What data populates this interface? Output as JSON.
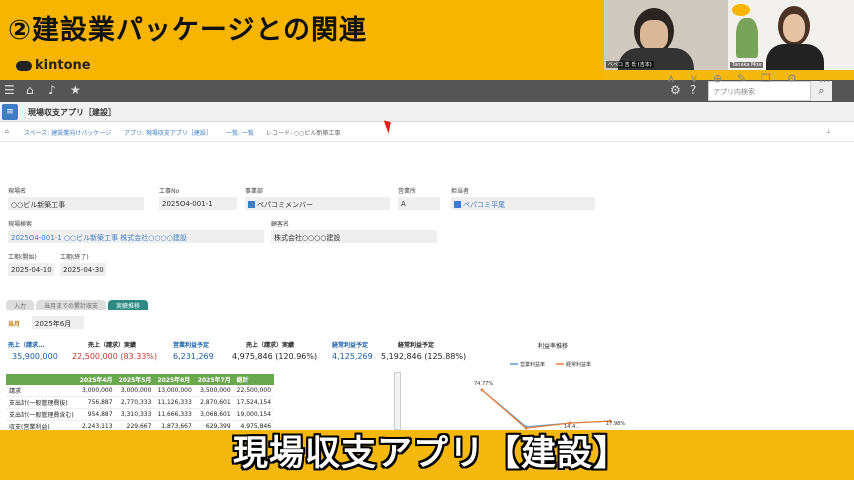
{
  "banner": {
    "title": "②建設業パッケージとの関連"
  },
  "brand": {
    "logo_text": "kintone"
  },
  "video": {
    "cam1_name": "ベペコ 吉 氏 (吉本)",
    "cam2_name": "Tanaka Moe",
    "accent": "#f7b500"
  },
  "topbar": {
    "search_placeholder": "アプリ内検索"
  },
  "app": {
    "name": "現場収支アプリ［建設］"
  },
  "breadcrumb": {
    "space": "スペース: 建設業向けパッケージ",
    "app": "アプリ: 現場収支アプリ［建設］",
    "list": "一覧: 一覧",
    "record": "レコード: ○○ビル新築工事"
  },
  "fields": {
    "site_name_label": "現場名",
    "site_name": "○○ビル新築工事",
    "job_no_label": "工事No",
    "job_no": "2025O4-001-1",
    "dept_label": "事業部",
    "dept": "ペパコミメンバー",
    "office_label": "営業所",
    "office": "A",
    "owner_label": "担当者",
    "owner": "ペパコミ平尾",
    "site_search_label": "現場検索",
    "site_search": "2025O4-001-1 ○○ビル新築工事 株式会社○○○○建設",
    "client_label": "顧客名",
    "client": "株式会社○○○○建設",
    "start_label": "工期(開始)",
    "start": "2025-04-10",
    "end_label": "工期(終了)",
    "end": "2025-04-30"
  },
  "tabs": [
    "入力",
    "当月までの累計収支",
    "実績推移"
  ],
  "month": {
    "label": "当月",
    "value": "2025年6月"
  },
  "kpis": {
    "heads": [
      "売上（請求...",
      "売上（請求）実績",
      "営業利益予定",
      "売上（請求）実績",
      "経常利益予定",
      "経常利益予定"
    ],
    "values": [
      "35,900,000",
      "22,500,000 (83.33%)",
      "6,231,269",
      "4,975,846 (120.96%)",
      "4,125,269",
      "5,192,846 (125.88%)"
    ]
  },
  "table": {
    "headers": [
      "",
      "2025年4月",
      "2025年5月",
      "2025年6月",
      "2025年7月",
      "総計"
    ],
    "rows": [
      [
        "請求",
        "3,000,000",
        "3,000,000",
        "13,000,000",
        "3,500,000",
        "22,500,000"
      ],
      [
        "支出計(一般管理費抜)",
        "756,887",
        "2,770,333",
        "11,126,333",
        "2,870,601",
        "17,524,154"
      ],
      [
        "支出計(一般管理費含む)",
        "954,887",
        "3,310,333",
        "11,666,333",
        "3,068,601",
        "19,000,154"
      ],
      [
        "収支(営業利益)",
        "2,243,113",
        "229,667",
        "1,873,667",
        "629,399",
        "4,975,846"
      ]
    ]
  },
  "chart_data": {
    "type": "line",
    "title": "利益率推移",
    "series": [
      {
        "name": "営業利益率",
        "values": [
          74.77,
          7.66,
          14.41,
          17.98
        ]
      },
      {
        "name": "経常利益率",
        "values": [
          74.77,
          5.0,
          14.4,
          17.98
        ]
      }
    ],
    "labels": [
      "74.77%",
      "14.4...",
      "17.98%"
    ],
    "colors": [
      "#5b9bd5",
      "#ed7d31"
    ]
  },
  "caption": {
    "text": "現場収支アプリ【建設】"
  }
}
